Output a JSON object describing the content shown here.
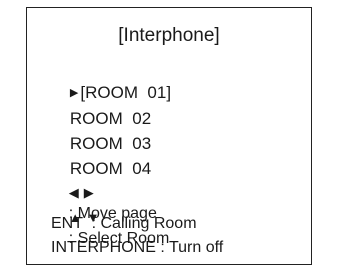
{
  "screen": {
    "title": "[Interphone]",
    "rooms": [
      {
        "label": "[ROOM  01]",
        "selected": true
      },
      {
        "label": "ROOM  02",
        "selected": false
      },
      {
        "label": "ROOM  03",
        "selected": false
      },
      {
        "label": "ROOM  04",
        "selected": false
      }
    ],
    "help": {
      "move_page": ": Move page",
      "select_room": ": Select Room",
      "ent": "ENT  : Calling Room",
      "interphone": "INTERPHONE : Turn off"
    },
    "icons": {
      "cursor": "selection-pointer-icon",
      "left": "triangle-left-icon",
      "right": "triangle-right-icon",
      "up": "triangle-up-icon",
      "down": "triangle-down-icon"
    }
  }
}
